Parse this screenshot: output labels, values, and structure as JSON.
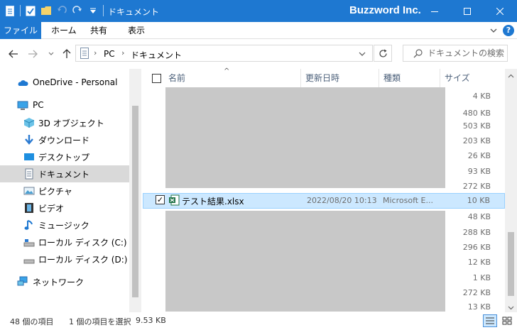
{
  "window": {
    "title": "ドキュメント",
    "brand": "Buzzword Inc."
  },
  "ribbon": {
    "tabs": [
      "ファイル",
      "ホーム",
      "共有",
      "表示"
    ]
  },
  "address": {
    "crumbs": [
      "PC",
      "ドキュメント"
    ]
  },
  "search": {
    "placeholder": "ドキュメントの検索"
  },
  "sidebar": {
    "items": [
      {
        "label": "OneDrive - Personal",
        "icon": "onedrive-icon"
      },
      {
        "label": "PC",
        "icon": "pc-icon"
      },
      {
        "label": "3D オブジェクト",
        "icon": "3d-objects-icon"
      },
      {
        "label": "ダウンロード",
        "icon": "download-icon"
      },
      {
        "label": "デスクトップ",
        "icon": "desktop-icon"
      },
      {
        "label": "ドキュメント",
        "icon": "document-icon",
        "selected": true
      },
      {
        "label": "ピクチャ",
        "icon": "pictures-icon"
      },
      {
        "label": "ビデオ",
        "icon": "video-icon"
      },
      {
        "label": "ミュージック",
        "icon": "music-icon"
      },
      {
        "label": "ローカル ディスク (C:)",
        "icon": "drive-icon"
      },
      {
        "label": "ローカル ディスク (D:)",
        "icon": "drive-icon"
      },
      {
        "label": "ネットワーク",
        "icon": "network-icon"
      }
    ]
  },
  "columns": {
    "name": "名前",
    "modified": "更新日時",
    "type": "種類",
    "size": "サイズ"
  },
  "files_above": [
    "4 KB",
    "480 KB",
    "503 KB",
    "203 KB",
    "26 KB",
    "93 KB",
    "272 KB"
  ],
  "selected_file": {
    "name": "テスト結果.xlsx",
    "modified": "2022/08/20 10:13",
    "type": "Microsoft E...",
    "size": "10 KB"
  },
  "files_below": [
    "48 KB",
    "288 KB",
    "296 KB",
    "12 KB",
    "1 KB",
    "272 KB",
    "13 KB"
  ],
  "status": {
    "item_count": "48 個の項目",
    "selection": "1 個の項目を選択",
    "selection_size": "9.53 KB"
  },
  "colors": {
    "accent": "#1e78d1",
    "selected_row": "#cce8ff",
    "redacted": "#c8c8c8"
  }
}
